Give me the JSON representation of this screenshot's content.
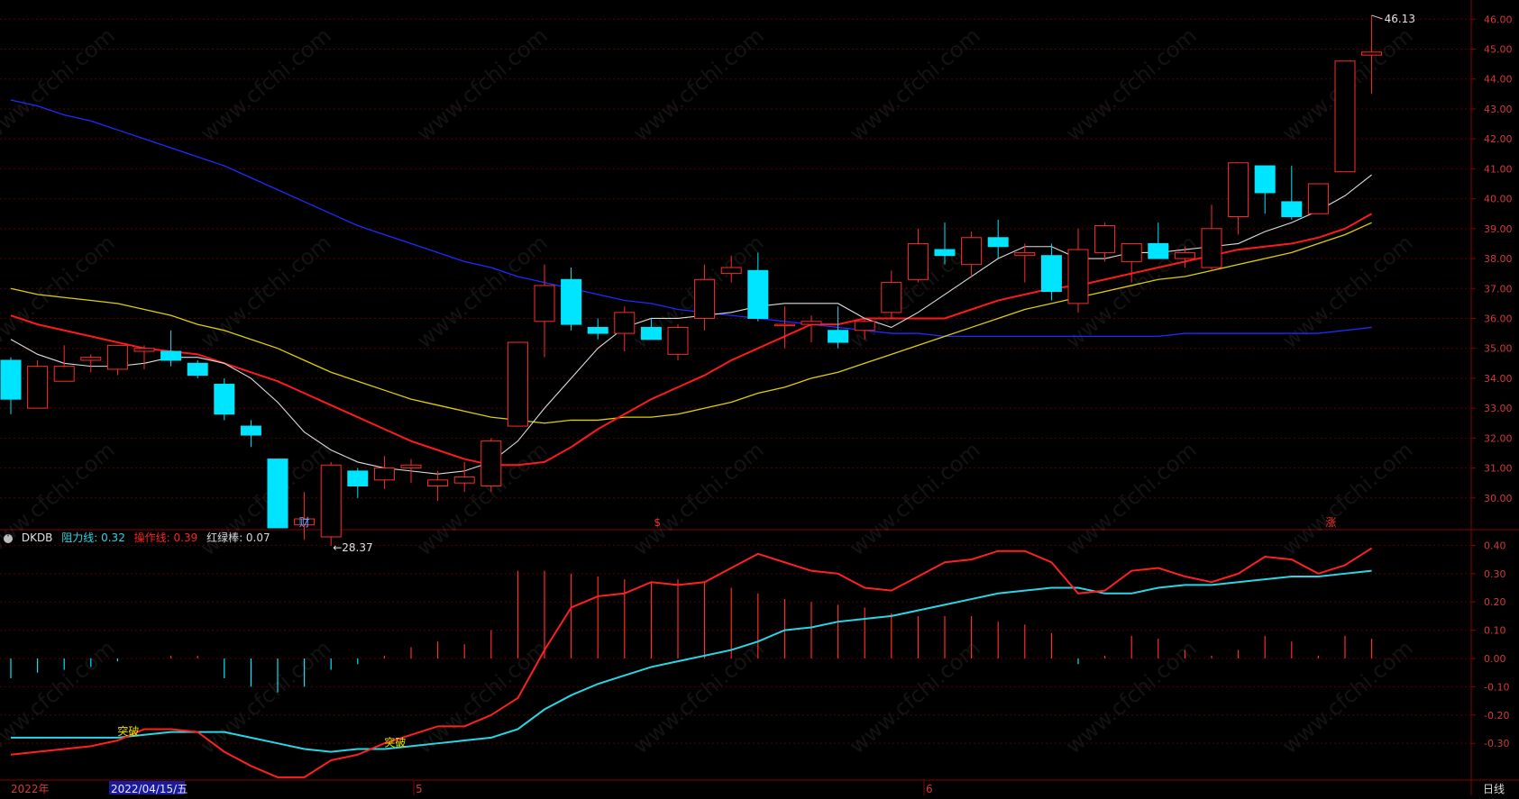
{
  "colors": {
    "bg": "#000000",
    "grid": "#5a0000",
    "frame": "#8a0000",
    "axis_text": "#d23a3a",
    "up": "#ff2a2a",
    "down": "#00e5ff",
    "ma5": "#dddddd",
    "ma10": "#ff1a1a",
    "ma20": "#e0d000",
    "ma60": "#1f2bff",
    "resistance": "#27d7e6",
    "operate": "#ff2020"
  },
  "price_axis": {
    "min": 29,
    "max": 46.4,
    "ticks": [
      "30.00",
      "31.00",
      "32.00",
      "33.00",
      "34.00",
      "35.00",
      "36.00",
      "37.00",
      "38.00",
      "39.00",
      "40.00",
      "41.00",
      "42.00",
      "43.00",
      "44.00",
      "45.00",
      "46.00"
    ]
  },
  "ind_axis": {
    "min": -0.43,
    "max": 0.43,
    "ticks": [
      "-0.30",
      "-0.20",
      "-0.10",
      "0.00",
      "0.10",
      "0.20",
      "0.30",
      "0.40"
    ]
  },
  "annotations": {
    "high_label": "46.13",
    "low_label": "28.37",
    "marker_cai": "财",
    "marker_s": "$",
    "marker_zhang": "涨",
    "breakout_1": "突破",
    "breakout_2": "突破"
  },
  "indicator_header": {
    "name": "DKDB",
    "resistance_label": "阻力线: 0.32",
    "operate_label": "操作线: 0.39",
    "bar_label": "红绿棒: 0.07"
  },
  "bottom_bar": {
    "year_label": "2022年",
    "date_label": "2022/04/15/五",
    "month_5": "5",
    "month_6": "6",
    "period_label": "日线"
  },
  "watermark": "www.cfchi.com",
  "chart_data": {
    "type": "candlestick",
    "candles": [
      {
        "o": 34.6,
        "h": 34.7,
        "l": 32.8,
        "c": 33.3
      },
      {
        "o": 33.0,
        "h": 34.6,
        "l": 33.0,
        "c": 34.4
      },
      {
        "o": 33.9,
        "h": 35.1,
        "l": 33.9,
        "c": 34.4
      },
      {
        "o": 34.6,
        "h": 34.8,
        "l": 34.2,
        "c": 34.7
      },
      {
        "o": 34.3,
        "h": 35.1,
        "l": 34.1,
        "c": 35.1
      },
      {
        "o": 34.9,
        "h": 35.1,
        "l": 34.3,
        "c": 35.0
      },
      {
        "o": 34.9,
        "h": 35.6,
        "l": 34.4,
        "c": 34.6
      },
      {
        "o": 34.5,
        "h": 34.6,
        "l": 34.0,
        "c": 34.1
      },
      {
        "o": 33.8,
        "h": 34.0,
        "l": 32.6,
        "c": 32.8
      },
      {
        "o": 32.4,
        "h": 32.6,
        "l": 31.7,
        "c": 32.1
      },
      {
        "o": 31.3,
        "h": 31.3,
        "l": 29.0,
        "c": 29.0
      },
      {
        "o": 29.1,
        "h": 30.2,
        "l": 28.6,
        "c": 29.3
      },
      {
        "o": 28.7,
        "h": 31.2,
        "l": 28.4,
        "c": 31.1
      },
      {
        "o": 30.9,
        "h": 31.0,
        "l": 30.0,
        "c": 30.4
      },
      {
        "o": 30.6,
        "h": 31.4,
        "l": 30.3,
        "c": 31.0
      },
      {
        "o": 31.0,
        "h": 31.3,
        "l": 30.5,
        "c": 31.1
      },
      {
        "o": 30.4,
        "h": 30.9,
        "l": 29.9,
        "c": 30.6
      },
      {
        "o": 30.5,
        "h": 31.2,
        "l": 30.2,
        "c": 30.7
      },
      {
        "o": 30.4,
        "h": 32.0,
        "l": 30.2,
        "c": 31.9
      },
      {
        "o": 32.4,
        "h": 35.2,
        "l": 32.4,
        "c": 35.2
      },
      {
        "o": 35.9,
        "h": 37.8,
        "l": 34.7,
        "c": 37.1
      },
      {
        "o": 37.3,
        "h": 37.7,
        "l": 35.6,
        "c": 35.8
      },
      {
        "o": 35.7,
        "h": 36.0,
        "l": 35.3,
        "c": 35.5
      },
      {
        "o": 35.5,
        "h": 36.4,
        "l": 34.9,
        "c": 36.2
      },
      {
        "o": 35.7,
        "h": 36.0,
        "l": 35.3,
        "c": 35.3
      },
      {
        "o": 34.8,
        "h": 35.8,
        "l": 34.6,
        "c": 35.7
      },
      {
        "o": 36.0,
        "h": 37.8,
        "l": 35.6,
        "c": 37.3
      },
      {
        "o": 37.5,
        "h": 38.1,
        "l": 37.2,
        "c": 37.7
      },
      {
        "o": 37.6,
        "h": 38.2,
        "l": 35.9,
        "c": 36.0
      },
      {
        "o": 35.8,
        "h": 36.4,
        "l": 35.0,
        "c": 35.8
      },
      {
        "o": 35.8,
        "h": 36.1,
        "l": 35.2,
        "c": 35.9
      },
      {
        "o": 35.6,
        "h": 36.4,
        "l": 35.0,
        "c": 35.2
      },
      {
        "o": 35.6,
        "h": 36.0,
        "l": 35.3,
        "c": 35.9
      },
      {
        "o": 36.2,
        "h": 37.6,
        "l": 36.0,
        "c": 37.2
      },
      {
        "o": 37.3,
        "h": 39.0,
        "l": 37.2,
        "c": 38.5
      },
      {
        "o": 38.3,
        "h": 39.2,
        "l": 37.8,
        "c": 38.1
      },
      {
        "o": 37.8,
        "h": 38.9,
        "l": 37.4,
        "c": 38.7
      },
      {
        "o": 38.7,
        "h": 39.3,
        "l": 38.0,
        "c": 38.4
      },
      {
        "o": 38.1,
        "h": 38.5,
        "l": 37.2,
        "c": 38.2
      },
      {
        "o": 38.1,
        "h": 38.5,
        "l": 36.6,
        "c": 36.9
      },
      {
        "o": 36.5,
        "h": 39.0,
        "l": 36.2,
        "c": 38.3
      },
      {
        "o": 38.2,
        "h": 39.2,
        "l": 37.9,
        "c": 39.1
      },
      {
        "o": 37.9,
        "h": 38.5,
        "l": 37.2,
        "c": 38.5
      },
      {
        "o": 38.5,
        "h": 39.2,
        "l": 38.0,
        "c": 38.0
      },
      {
        "o": 38.0,
        "h": 38.4,
        "l": 37.7,
        "c": 38.2
      },
      {
        "o": 37.7,
        "h": 39.8,
        "l": 37.6,
        "c": 39.0
      },
      {
        "o": 39.4,
        "h": 41.2,
        "l": 38.8,
        "c": 41.2
      },
      {
        "o": 41.1,
        "h": 41.1,
        "l": 39.5,
        "c": 40.2
      },
      {
        "o": 39.9,
        "h": 41.1,
        "l": 39.3,
        "c": 39.4
      },
      {
        "o": 39.5,
        "h": 40.5,
        "l": 39.5,
        "c": 40.5
      },
      {
        "o": 40.9,
        "h": 44.6,
        "l": 40.9,
        "c": 44.6
      },
      {
        "o": 44.8,
        "h": 46.13,
        "l": 43.5,
        "c": 44.9
      }
    ],
    "ma5": [
      35.3,
      34.8,
      34.5,
      34.4,
      34.4,
      34.5,
      34.7,
      34.7,
      34.5,
      34.0,
      33.2,
      32.2,
      31.6,
      31.2,
      31.0,
      30.9,
      30.8,
      30.9,
      31.2,
      31.9,
      33.0,
      34.0,
      35.0,
      35.7,
      36.0,
      36.0,
      36.1,
      36.2,
      36.4,
      36.5,
      36.5,
      36.5,
      36.0,
      35.7,
      36.2,
      36.8,
      37.4,
      38.0,
      38.4,
      38.4,
      38.0,
      38.0,
      38.2,
      38.2,
      38.3,
      38.4,
      38.5,
      38.9,
      39.2,
      39.6,
      40.1,
      40.8
    ],
    "ma10": [
      36.1,
      35.8,
      35.6,
      35.4,
      35.2,
      35.0,
      34.9,
      34.8,
      34.5,
      34.2,
      33.9,
      33.5,
      33.1,
      32.7,
      32.3,
      31.9,
      31.6,
      31.3,
      31.1,
      31.1,
      31.2,
      31.7,
      32.3,
      32.8,
      33.3,
      33.7,
      34.1,
      34.6,
      35.0,
      35.4,
      35.8,
      35.8,
      36.0,
      36.0,
      36.0,
      36.0,
      36.3,
      36.6,
      36.8,
      37.0,
      37.1,
      37.3,
      37.5,
      37.7,
      37.9,
      38.1,
      38.3,
      38.4,
      38.5,
      38.7,
      39.0,
      39.5
    ],
    "ma20": [
      37.0,
      36.8,
      36.7,
      36.6,
      36.5,
      36.3,
      36.1,
      35.8,
      35.6,
      35.3,
      35.0,
      34.6,
      34.2,
      33.9,
      33.6,
      33.3,
      33.1,
      32.9,
      32.7,
      32.6,
      32.5,
      32.6,
      32.6,
      32.7,
      32.7,
      32.8,
      33.0,
      33.2,
      33.5,
      33.7,
      34.0,
      34.2,
      34.5,
      34.8,
      35.1,
      35.4,
      35.7,
      36.0,
      36.3,
      36.5,
      36.7,
      36.9,
      37.1,
      37.3,
      37.4,
      37.6,
      37.8,
      38.0,
      38.2,
      38.5,
      38.8,
      39.2
    ],
    "ma60": [
      43.3,
      43.1,
      42.8,
      42.6,
      42.3,
      42.0,
      41.7,
      41.4,
      41.1,
      40.7,
      40.3,
      39.9,
      39.5,
      39.1,
      38.8,
      38.5,
      38.2,
      37.9,
      37.7,
      37.4,
      37.2,
      37.0,
      36.8,
      36.6,
      36.5,
      36.3,
      36.2,
      36.1,
      36.0,
      35.9,
      35.8,
      35.7,
      35.6,
      35.5,
      35.5,
      35.4,
      35.4,
      35.4,
      35.4,
      35.4,
      35.4,
      35.4,
      35.4,
      35.4,
      35.5,
      35.5,
      35.5,
      35.5,
      35.5,
      35.5,
      35.6,
      35.7
    ],
    "resistance": [
      -0.28,
      -0.28,
      -0.28,
      -0.28,
      -0.28,
      -0.27,
      -0.26,
      -0.26,
      -0.26,
      -0.28,
      -0.3,
      -0.32,
      -0.33,
      -0.32,
      -0.32,
      -0.31,
      -0.3,
      -0.29,
      -0.28,
      -0.25,
      -0.18,
      -0.13,
      -0.09,
      -0.06,
      -0.03,
      -0.01,
      0.01,
      0.03,
      0.06,
      0.1,
      0.11,
      0.13,
      0.14,
      0.15,
      0.17,
      0.19,
      0.21,
      0.23,
      0.24,
      0.25,
      0.25,
      0.23,
      0.23,
      0.25,
      0.26,
      0.26,
      0.27,
      0.28,
      0.29,
      0.29,
      0.3,
      0.31
    ],
    "operate": [
      -0.34,
      -0.33,
      -0.32,
      -0.31,
      -0.29,
      -0.25,
      -0.25,
      -0.26,
      -0.33,
      -0.38,
      -0.42,
      -0.42,
      -0.36,
      -0.34,
      -0.3,
      -0.27,
      -0.24,
      -0.24,
      -0.2,
      -0.14,
      0.03,
      0.18,
      0.22,
      0.23,
      0.27,
      0.26,
      0.27,
      0.32,
      0.37,
      0.34,
      0.31,
      0.3,
      0.25,
      0.24,
      0.29,
      0.34,
      0.35,
      0.38,
      0.38,
      0.34,
      0.23,
      0.24,
      0.31,
      0.32,
      0.29,
      0.27,
      0.3,
      0.36,
      0.35,
      0.3,
      0.33,
      0.39
    ],
    "bars": [
      -0.07,
      -0.05,
      -0.04,
      -0.03,
      -0.01,
      0.0,
      0.01,
      0.01,
      -0.07,
      -0.1,
      -0.12,
      -0.1,
      -0.04,
      -0.02,
      0.01,
      0.04,
      0.06,
      0.05,
      0.1,
      0.31,
      0.31,
      0.3,
      0.29,
      0.28,
      0.27,
      0.28,
      0.27,
      0.25,
      0.23,
      0.21,
      0.2,
      0.19,
      0.18,
      0.16,
      0.15,
      0.15,
      0.15,
      0.13,
      0.12,
      0.09,
      -0.02,
      0.01,
      0.08,
      0.07,
      0.03,
      0.01,
      0.03,
      0.08,
      0.06,
      0.01,
      0.08,
      0.07
    ]
  }
}
